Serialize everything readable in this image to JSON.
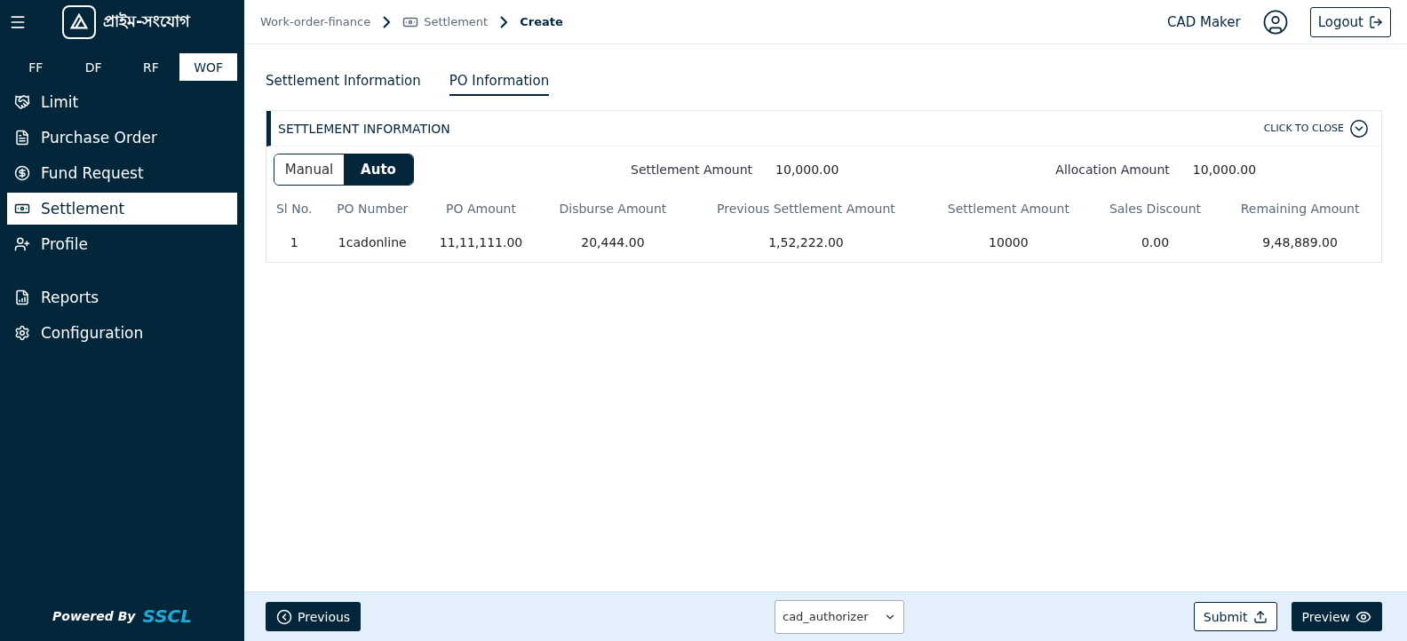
{
  "brand": {
    "name": "প্রাইম-সংযোগ"
  },
  "product_tabs": [
    {
      "label": "FF",
      "selected": false
    },
    {
      "label": "DF",
      "selected": false
    },
    {
      "label": "RF",
      "selected": false
    },
    {
      "label": "WOF",
      "selected": true
    }
  ],
  "nav_groups": [
    [
      {
        "label": "Limit",
        "selected": false
      },
      {
        "label": "Purchase Order",
        "selected": false
      },
      {
        "label": "Fund Request",
        "selected": false
      },
      {
        "label": "Settlement",
        "selected": true
      },
      {
        "label": "Profile",
        "selected": false
      }
    ],
    [
      {
        "label": "Reports",
        "selected": false
      },
      {
        "label": "Configuration",
        "selected": false
      }
    ]
  ],
  "powered_by": {
    "label": "Powered By",
    "brand": "SSCL"
  },
  "breadcrumbs": [
    {
      "label": "Work-order-finance",
      "current": false
    },
    {
      "label": "Settlement",
      "current": false
    },
    {
      "label": "Create",
      "current": true
    }
  ],
  "user": {
    "name": "CAD Maker",
    "logout": "Logout"
  },
  "page_tabs": [
    {
      "label": "Settlement Information",
      "selected": false
    },
    {
      "label": "PO Information",
      "selected": true
    }
  ],
  "section": {
    "title": "SETTLEMENT INFORMATION",
    "toggle_label": "CLICK TO CLOSE",
    "expanded": true
  },
  "mode_toggle": [
    {
      "label": "Manual",
      "selected": false
    },
    {
      "label": "Auto",
      "selected": true
    }
  ],
  "summary": [
    {
      "label": "Settlement Amount",
      "value": "10,000.00"
    },
    {
      "label": "Allocation Amount",
      "value": "10,000.00"
    }
  ],
  "table": {
    "columns": [
      "Sl No.",
      "PO Number",
      "PO Amount",
      "Disburse Amount",
      "Previous Settlement Amount",
      "Settlement Amount",
      "Sales Discount",
      "Remaining Amount"
    ],
    "rows": [
      [
        "1",
        "1cadonline",
        "11,11,111.00",
        "20,444.00",
        "1,52,222.00",
        "10000",
        "0.00",
        "9,48,889.00"
      ]
    ]
  },
  "footer": {
    "previous": "Previous",
    "select_value": "cad_authorizer",
    "submit": "Submit",
    "preview": "Preview"
  }
}
